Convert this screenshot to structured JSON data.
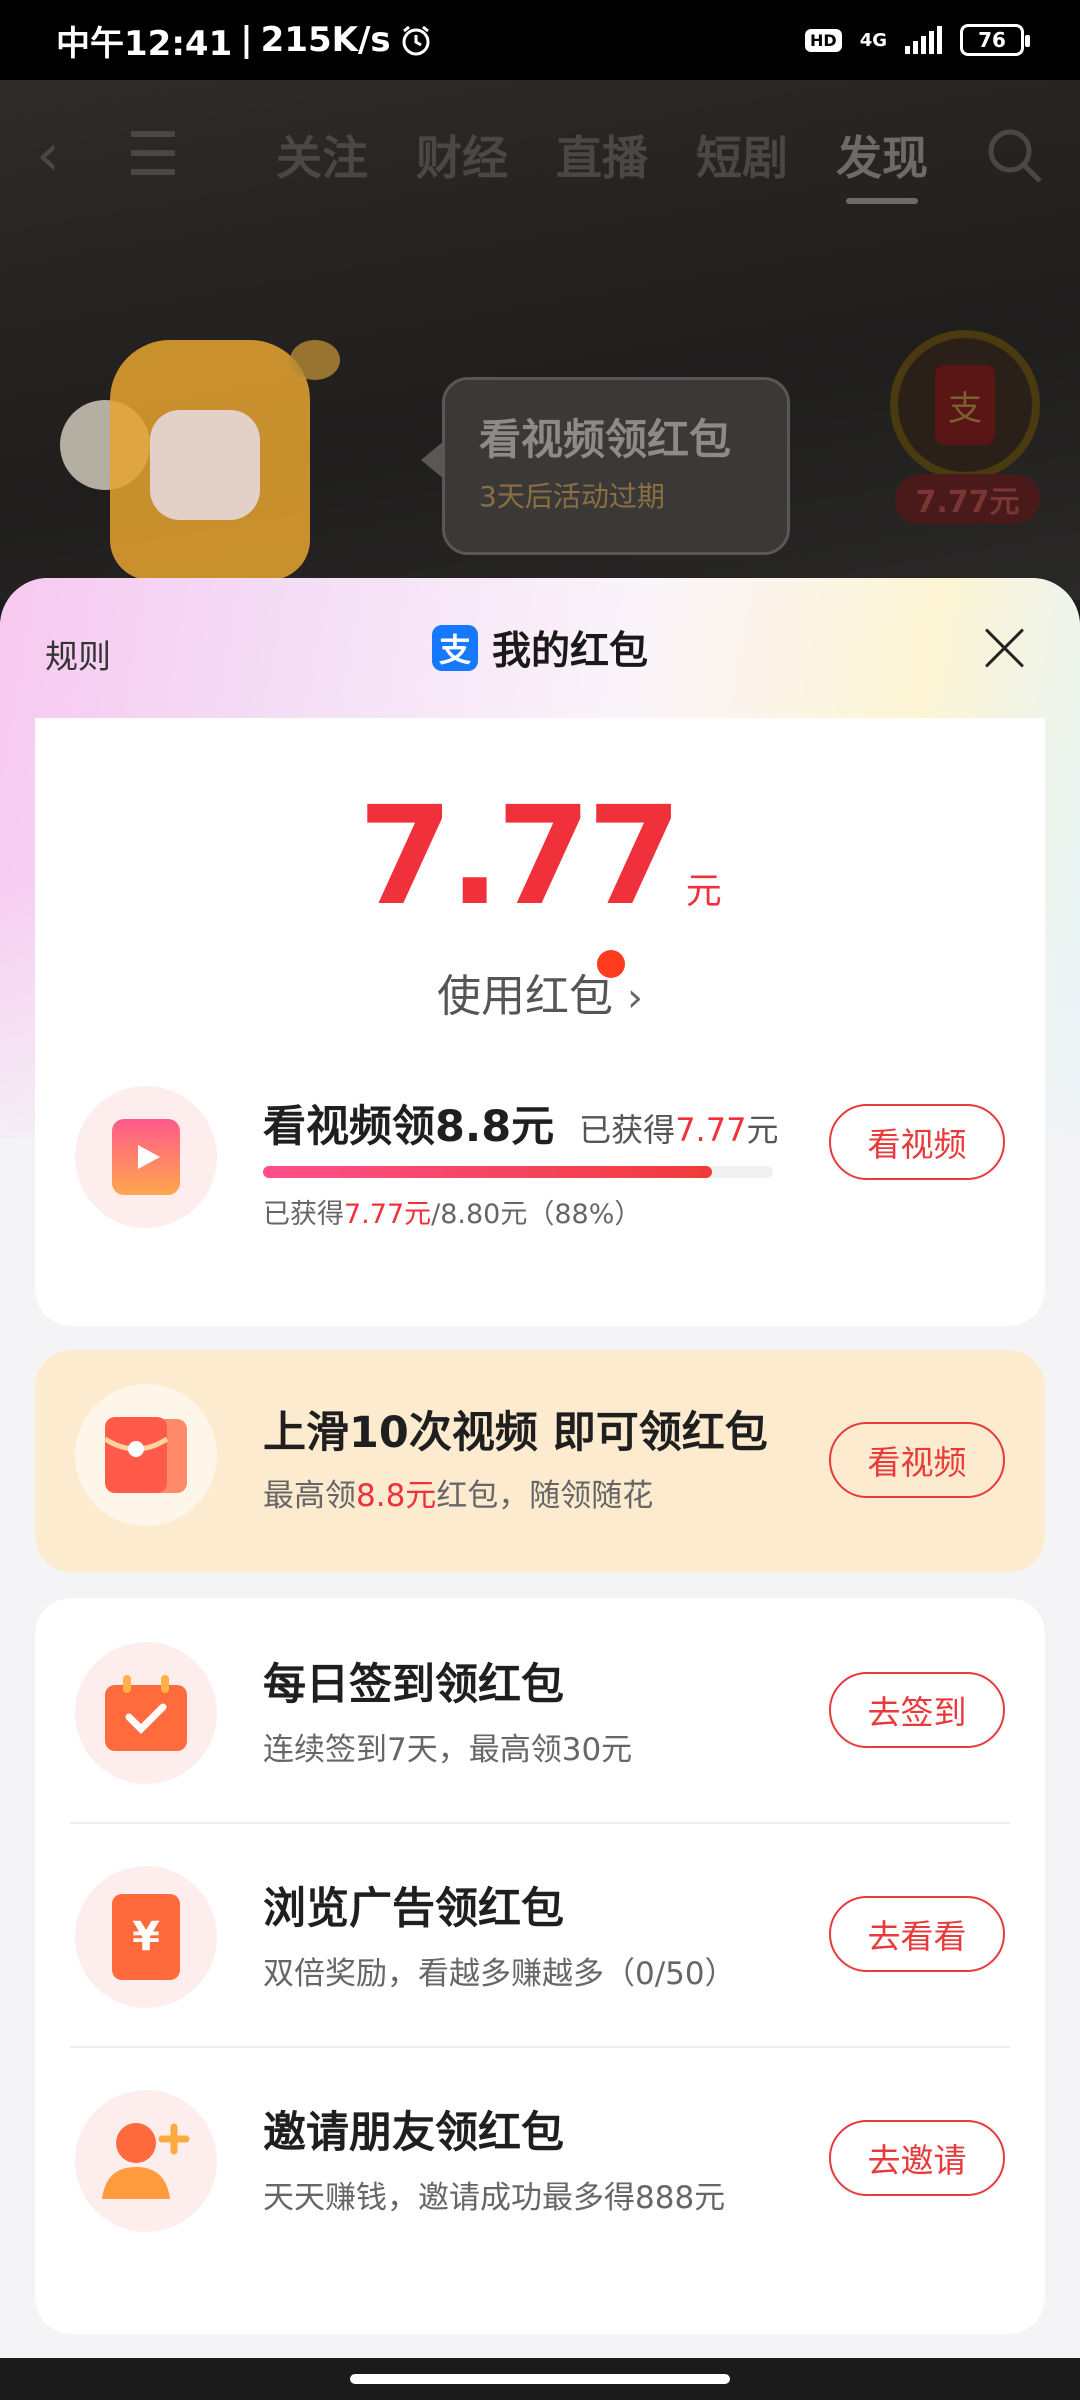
{
  "status_bar": {
    "time": "中午12:41",
    "speed": "215K/s",
    "hd": "HD",
    "network": "4G",
    "battery": "76"
  },
  "background": {
    "tabs": [
      "关注",
      "财经",
      "直播",
      "短剧",
      "发现"
    ],
    "bubble_title": "看视频领红包",
    "bubble_sub": "3天后活动过期",
    "side_badge_amount": "7.77元",
    "side_badge_icon_char": "支"
  },
  "sheet": {
    "rules": "规则",
    "title": "我的红包",
    "title_icon_char": "支",
    "amount": "7.77",
    "amount_unit": "元",
    "use_link": "使用红包",
    "watch_task": {
      "title": "看视频领8.8元",
      "earned_prefix": "已获得",
      "earned_value": "7.77",
      "earned_suffix": "元",
      "progress_prefix": "已获得",
      "progress_value": "7.77元",
      "progress_total": "/8.80元（88%）",
      "progress_fraction": 0.88,
      "button": "看视频"
    },
    "promo_task": {
      "title": "上滑10次视频 即可领红包",
      "sub_prefix": "最高领",
      "sub_value": "8.8元",
      "sub_suffix": "红包，随领随花",
      "button": "看视频"
    },
    "tasks": [
      {
        "title": "每日签到领红包",
        "sub": "连续签到7天，最高领30元",
        "button": "去签到",
        "icon": "calendar-check-icon"
      },
      {
        "title": "浏览广告领红包",
        "sub": "双倍奖励，看越多赚越多（0/50）",
        "button": "去看看",
        "icon": "yuan-card-icon"
      },
      {
        "title": "邀请朋友领红包",
        "sub": "天天赚钱，邀请成功最多得888元",
        "button": "去邀请",
        "icon": "add-friend-icon"
      }
    ]
  },
  "colors": {
    "accent_red": "#f0303a",
    "alipay_blue": "#1677ff",
    "promo_bg": "#fdebd0"
  }
}
